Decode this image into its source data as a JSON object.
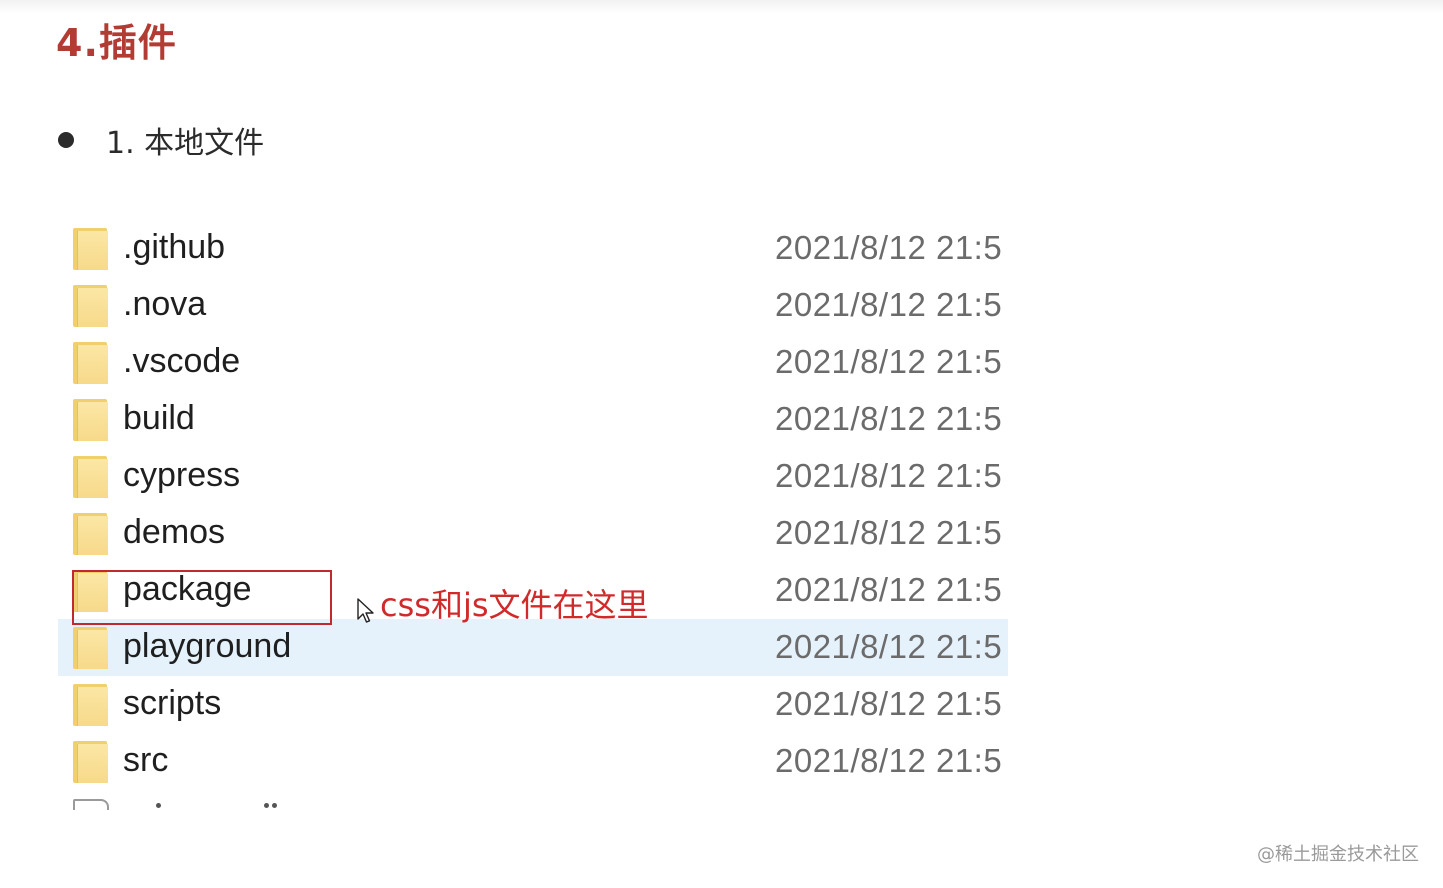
{
  "heading": "4.插件",
  "list_item": "1. 本地文件",
  "files": [
    {
      "name": ".github",
      "date": "2021/8/12 21:5",
      "icon": "folder-icon",
      "selected": false
    },
    {
      "name": ".nova",
      "date": "2021/8/12 21:5",
      "icon": "folder-icon",
      "selected": false
    },
    {
      "name": ".vscode",
      "date": "2021/8/12 21:5",
      "icon": "folder-icon",
      "selected": false
    },
    {
      "name": "build",
      "date": "2021/8/12 21:5",
      "icon": "folder-icon",
      "selected": false
    },
    {
      "name": "cypress",
      "date": "2021/8/12 21:5",
      "icon": "folder-icon",
      "selected": false
    },
    {
      "name": "demos",
      "date": "2021/8/12 21:5",
      "icon": "folder-icon",
      "selected": false
    },
    {
      "name": "package",
      "date": "2021/8/12 21:5",
      "icon": "folder-icon",
      "selected": false
    },
    {
      "name": "playground",
      "date": "2021/8/12 21:5",
      "icon": "folder-icon",
      "selected": true
    },
    {
      "name": "scripts",
      "date": "2021/8/12 21:5",
      "icon": "folder-icon",
      "selected": false
    },
    {
      "name": "src",
      "date": "2021/8/12 21:5",
      "icon": "folder-icon",
      "selected": false
    }
  ],
  "annotation": "css和js文件在这里",
  "watermark": "@稀土掘金技术社区",
  "colors": {
    "heading": "#b23b33",
    "annotation": "#d02a2a",
    "highlight_box": "#c0292f",
    "selected_row": "#e5f1fb",
    "folder": "#f7d98a"
  }
}
